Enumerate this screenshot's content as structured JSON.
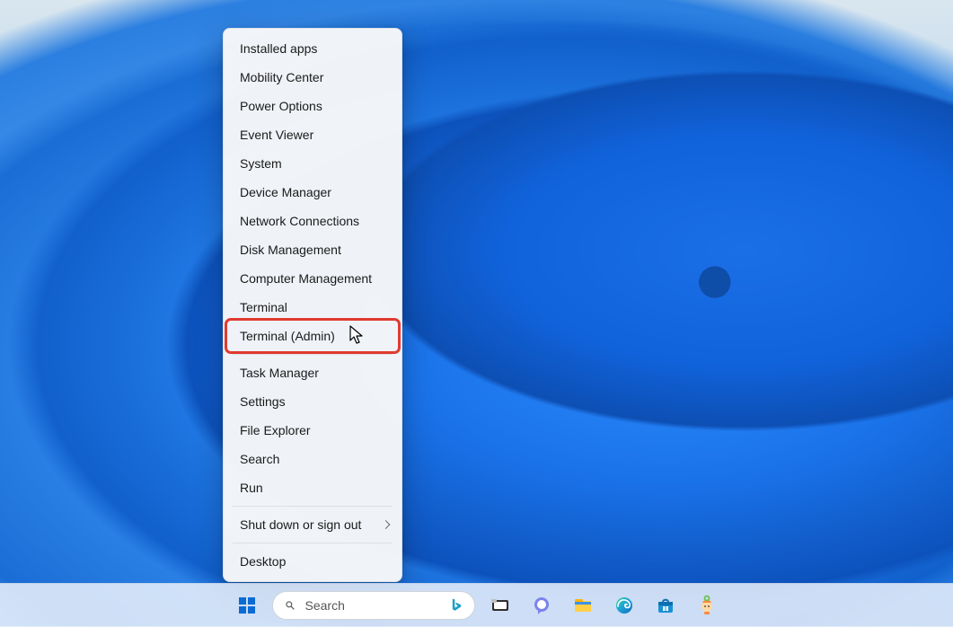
{
  "menu": {
    "groups": [
      {
        "items": [
          {
            "id": "installed-apps",
            "label": "Installed apps"
          },
          {
            "id": "mobility-center",
            "label": "Mobility Center"
          },
          {
            "id": "power-options",
            "label": "Power Options"
          },
          {
            "id": "event-viewer",
            "label": "Event Viewer"
          },
          {
            "id": "system",
            "label": "System"
          },
          {
            "id": "device-manager",
            "label": "Device Manager"
          },
          {
            "id": "network-connections",
            "label": "Network Connections"
          },
          {
            "id": "disk-management",
            "label": "Disk Management"
          },
          {
            "id": "computer-management",
            "label": "Computer Management"
          },
          {
            "id": "terminal",
            "label": "Terminal"
          },
          {
            "id": "terminal-admin",
            "label": "Terminal (Admin)",
            "highlighted": true
          }
        ]
      },
      {
        "items": [
          {
            "id": "task-manager",
            "label": "Task Manager"
          },
          {
            "id": "settings",
            "label": "Settings"
          },
          {
            "id": "file-explorer",
            "label": "File Explorer"
          },
          {
            "id": "search",
            "label": "Search"
          },
          {
            "id": "run",
            "label": "Run"
          }
        ]
      },
      {
        "items": [
          {
            "id": "shut-down-sign-out",
            "label": "Shut down or sign out",
            "submenu": true
          }
        ]
      },
      {
        "items": [
          {
            "id": "desktop",
            "label": "Desktop"
          }
        ]
      }
    ]
  },
  "search": {
    "placeholder": "Search"
  },
  "taskbar": {
    "items": [
      {
        "id": "start",
        "name": "start-button",
        "icon": "windows"
      },
      {
        "id": "search",
        "name": "taskbar-search",
        "icon": "searchbox"
      },
      {
        "id": "task-view",
        "name": "task-view-button",
        "icon": "taskview"
      },
      {
        "id": "chat",
        "name": "chat-button",
        "icon": "chat"
      },
      {
        "id": "file-explorer",
        "name": "file-explorer-button",
        "icon": "explorer"
      },
      {
        "id": "edge",
        "name": "edge-button",
        "icon": "edge"
      },
      {
        "id": "store",
        "name": "store-button",
        "icon": "store"
      },
      {
        "id": "assistant",
        "name": "assistant-button",
        "icon": "assistant"
      }
    ]
  },
  "colors": {
    "highlight": "#e03a2f",
    "menu_bg": "#f9f9f9",
    "taskbar_bg": "rgba(245,248,252,0.82)"
  }
}
